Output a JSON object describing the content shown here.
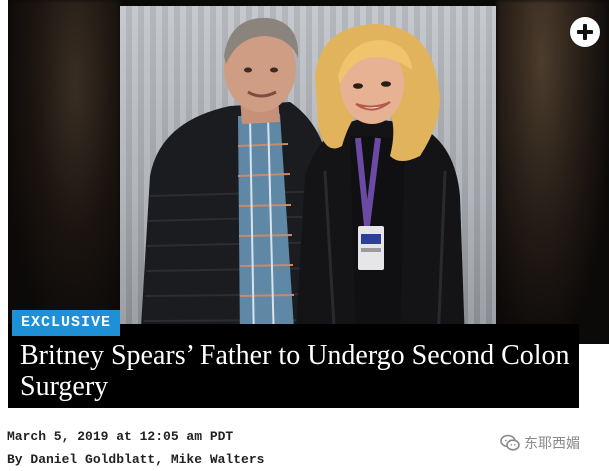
{
  "hero": {
    "badge_label": "EXCLUSIVE",
    "expand_icon": "plus-circle-icon"
  },
  "article": {
    "headline": "Britney Spears’ Father to Undergo Second Colon Surgery",
    "date": "March 5, 2019 at 12:05 am PDT",
    "byline": "By Daniel Goldblatt, Mike Walters"
  },
  "watermark": {
    "icon": "wechat-icon",
    "text": "东耶西媚"
  },
  "colors": {
    "badge": "#1f8fd6",
    "headline_bg": "#000000",
    "headline_text": "#ffffff"
  }
}
